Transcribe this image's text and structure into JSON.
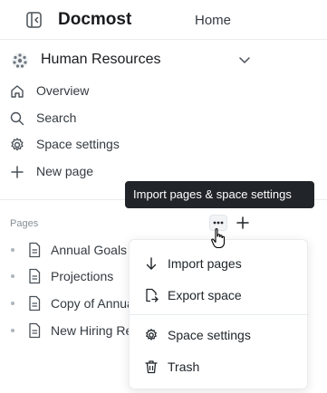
{
  "header": {
    "app_name": "Docmost",
    "home_label": "Home",
    "toggle_icon": "sidebar-toggle-icon"
  },
  "space": {
    "name": "Human Resources",
    "avatar_icon": "space-avatar-icon",
    "chevron_icon": "chevron-down-icon"
  },
  "nav": {
    "items": [
      {
        "label": "Overview",
        "icon": "home-icon"
      },
      {
        "label": "Search",
        "icon": "search-icon"
      },
      {
        "label": "Space settings",
        "icon": "gear-icon"
      },
      {
        "label": "New page",
        "icon": "plus-icon"
      }
    ]
  },
  "pages": {
    "section_label": "Pages",
    "tooltip": "Import pages & space settings",
    "tree": [
      {
        "title": "Annual Goals"
      },
      {
        "title": "Projections"
      },
      {
        "title": "Copy of Annual Goals"
      },
      {
        "title": "New Hiring Requirements"
      }
    ]
  },
  "menu": {
    "items": [
      {
        "label": "Import pages",
        "icon": "arrow-down-icon"
      },
      {
        "label": "Export space",
        "icon": "export-icon"
      },
      {
        "label": "Space settings",
        "icon": "gear-icon"
      },
      {
        "label": "Trash",
        "icon": "trash-icon"
      }
    ]
  },
  "colors": {
    "text": "#212529",
    "muted": "#868e96",
    "tooltip_bg": "#212529",
    "divider": "#e9ecef"
  }
}
